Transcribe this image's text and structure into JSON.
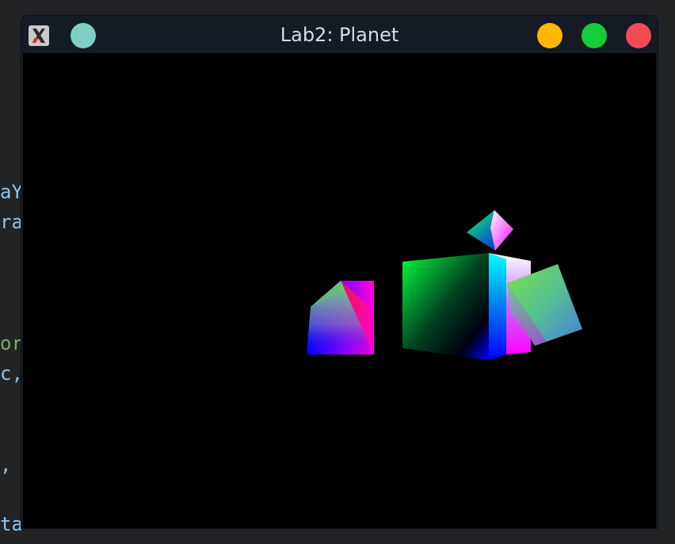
{
  "window": {
    "title": "Lab2: Planet",
    "app_icon": "x-window-icon",
    "pin_button": "pin-icon",
    "buttons": {
      "minimize": "minimize-icon",
      "maximize": "maximize-icon",
      "close": "close-icon"
    }
  },
  "background_code": {
    "lines": [
      "aY",
      "ra",
      "or",
      "c,",
      ",",
      "ta"
    ]
  },
  "colors": {
    "titlebar": "#141b24",
    "desktop": "#222325",
    "viewport": "#000000",
    "pin": "#7ecfc6",
    "minimize": "#ffb702",
    "maximize": "#15cc3a",
    "close": "#f34b55",
    "code_text": "#8fc6ec",
    "code_comment": "#7fa86a"
  },
  "scene": {
    "objects": [
      "pyramid",
      "cube",
      "small-diamond",
      "tilted-cube"
    ]
  }
}
